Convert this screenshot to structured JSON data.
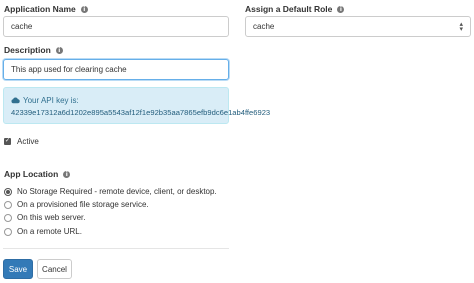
{
  "app_name": {
    "label": "Application Name",
    "value": "cache"
  },
  "default_role": {
    "label": "Assign a Default Role",
    "selected": "cache"
  },
  "description": {
    "label": "Description",
    "value": "This app used for clearing cache"
  },
  "api_key": {
    "title": "Your API key is:",
    "value": "42339e17312a6d1202e895a5543af12f1e92b35aa7865efb9dc6e1ab4ffe6923"
  },
  "active": {
    "label": "Active",
    "checked": true
  },
  "location": {
    "label": "App Location",
    "options": [
      {
        "label": "No Storage Required - remote device, client, or desktop.",
        "selected": true
      },
      {
        "label": "On a provisioned file storage service.",
        "selected": false
      },
      {
        "label": "On this web server.",
        "selected": false
      },
      {
        "label": "On a remote URL.",
        "selected": false
      }
    ]
  },
  "buttons": {
    "save": "Save",
    "cancel": "Cancel"
  },
  "icons": {
    "info": "info-icon",
    "cloud": "cloud-icon",
    "caret": "select-caret-icon"
  },
  "colors": {
    "primary": "#337ab7",
    "alert_bg": "#d9edf7",
    "alert_text": "#31708f",
    "focus": "#66afe9"
  }
}
